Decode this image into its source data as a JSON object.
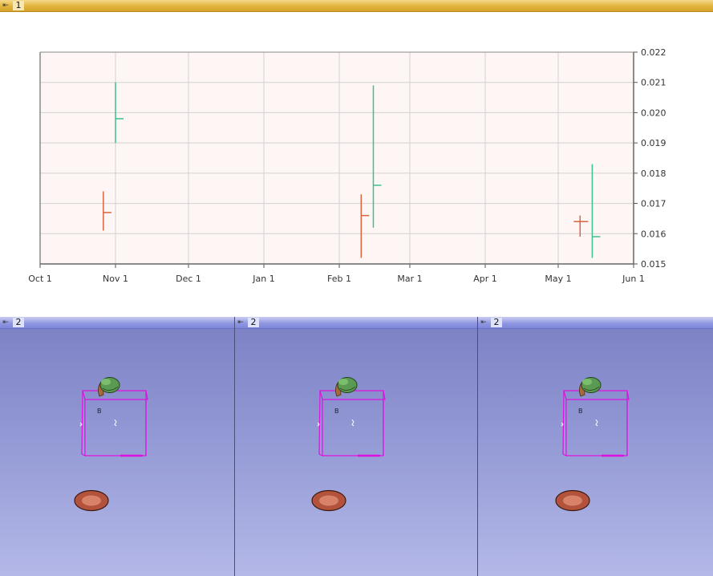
{
  "top_view": {
    "pin_icon": "pin-icon",
    "view_number": "1"
  },
  "bottom_views": [
    {
      "pin_icon": "pin-icon",
      "view_number": "2"
    },
    {
      "pin_icon": "pin-icon",
      "view_number": "2"
    },
    {
      "pin_icon": "pin-icon",
      "view_number": "2"
    }
  ],
  "colors": {
    "top_bar": "#e2b43b",
    "bottom_bar": "#8e95e0",
    "plot_background": "#fdf6f4",
    "series_up": "#3cc08e",
    "series_down": "#d9643f",
    "bounding_box": "#e010e0"
  },
  "chart_data": {
    "type": "ohlc",
    "title": "",
    "xlabel": "",
    "ylabel": "",
    "x_axis": {
      "type": "date",
      "ticks": [
        "Oct 1",
        "Nov 1",
        "Dec 1",
        "Jan 1",
        "Feb 1",
        "Mar 1",
        "Apr 1",
        "May 1",
        "Jun 1"
      ]
    },
    "y_axis": {
      "position": "right",
      "ylim": [
        0.015,
        0.022
      ],
      "ticks": [
        "0.015",
        "0.016",
        "0.017",
        "0.018",
        "0.019",
        "0.020",
        "0.021",
        "0.022"
      ]
    },
    "grid": true,
    "series": [
      {
        "date": "2019-10-27",
        "high": 0.0174,
        "low": 0.0161,
        "open": null,
        "close": 0.0167,
        "direction": "down"
      },
      {
        "date": "2019-11-01",
        "high": 0.021,
        "low": 0.019,
        "open": null,
        "close": 0.0198,
        "direction": "up"
      },
      {
        "date": "2020-02-10",
        "high": 0.0173,
        "low": 0.0152,
        "open": null,
        "close": 0.0166,
        "direction": "down"
      },
      {
        "date": "2020-02-15",
        "high": 0.0209,
        "low": 0.0162,
        "open": null,
        "close": 0.0176,
        "direction": "up"
      },
      {
        "date": "2020-05-10",
        "high": 0.0166,
        "low": 0.0159,
        "open": 0.0164,
        "close": 0.0164,
        "direction": "down"
      },
      {
        "date": "2020-05-15",
        "high": 0.0183,
        "low": 0.0152,
        "open": null,
        "close": 0.0159,
        "direction": "up"
      }
    ]
  },
  "scene": {
    "objects": [
      "bounding-box",
      "lung-model",
      "letter-marker",
      "disk-object"
    ],
    "marker_text": "B"
  }
}
